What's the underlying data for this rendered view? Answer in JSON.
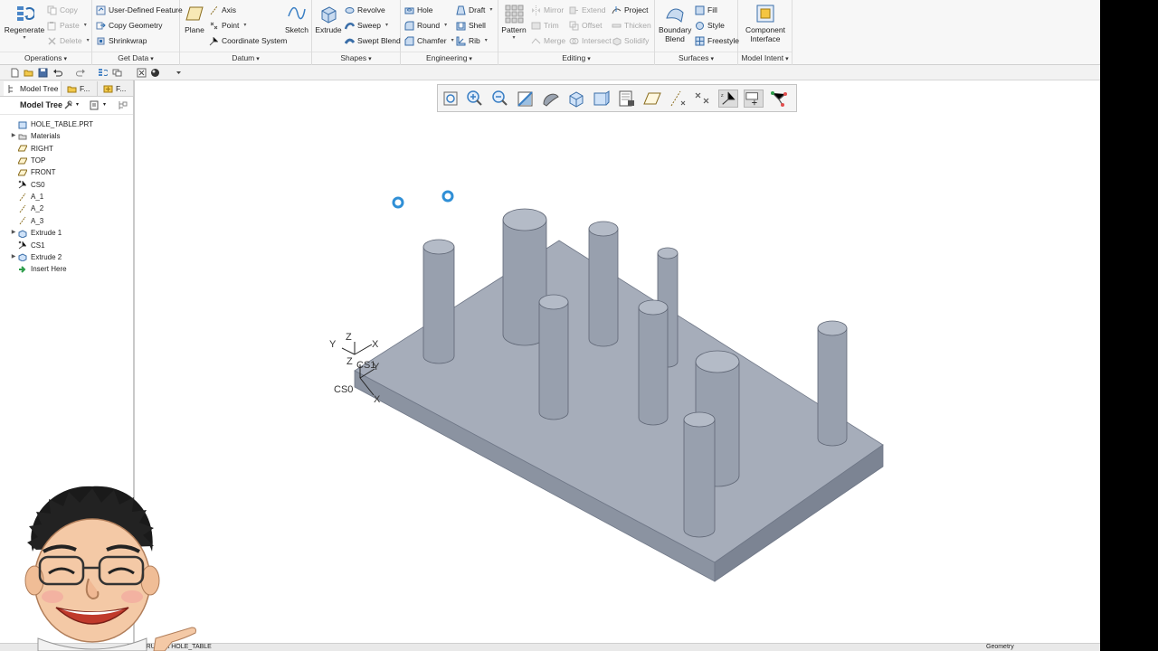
{
  "ribbon": {
    "groups": [
      {
        "label": "Operations"
      },
      {
        "label": "Get Data"
      },
      {
        "label": "Datum"
      },
      {
        "label": "Shapes"
      },
      {
        "label": "Engineering"
      },
      {
        "label": "Editing"
      },
      {
        "label": "Surfaces"
      },
      {
        "label": "Model Intent"
      }
    ],
    "operations": {
      "regenerate": "Regenerate",
      "copy": "Copy",
      "paste": "Paste",
      "delete": "Delete"
    },
    "get_data": {
      "udf": "User-Defined Feature",
      "copy_geometry": "Copy Geometry",
      "shrinkwrap": "Shrinkwrap"
    },
    "datum": {
      "plane": "Plane",
      "axis": "Axis",
      "point": "Point",
      "coordinate_system": "Coordinate System",
      "sketch": "Sketch"
    },
    "shapes": {
      "extrude": "Extrude",
      "revolve": "Revolve",
      "sweep": "Sweep",
      "swept_blend": "Swept Blend"
    },
    "engineering": {
      "hole": "Hole",
      "round": "Round",
      "chamfer": "Chamfer",
      "draft": "Draft",
      "shell": "Shell",
      "rib": "Rib"
    },
    "editing": {
      "pattern": "Pattern",
      "mirror": "Mirror",
      "trim": "Trim",
      "merge": "Merge",
      "extend": "Extend",
      "offset": "Offset",
      "intersect": "Intersect",
      "project": "Project",
      "thicken": "Thicken",
      "solidify": "Solidify"
    },
    "surfaces": {
      "boundary_blend_1": "Boundary",
      "boundary_blend_2": "Blend",
      "fill": "Fill",
      "style": "Style",
      "freestyle": "Freestyle"
    },
    "model_intent": {
      "component_interface_1": "Component",
      "component_interface_2": "Interface"
    }
  },
  "panel": {
    "tabs": [
      {
        "label": "Model Tree"
      },
      {
        "label": "F..."
      },
      {
        "label": "F..."
      }
    ],
    "title": "Model Tree"
  },
  "tree": {
    "items": [
      {
        "label": "HOLE_TABLE.PRT",
        "icon": "part-icon",
        "expandable": false
      },
      {
        "label": "Materials",
        "icon": "materials-icon",
        "expandable": true
      },
      {
        "label": "RIGHT",
        "icon": "datum-plane-icon",
        "expandable": false
      },
      {
        "label": "TOP",
        "icon": "datum-plane-icon",
        "expandable": false
      },
      {
        "label": "FRONT",
        "icon": "datum-plane-icon",
        "expandable": false
      },
      {
        "label": "CS0",
        "icon": "csys-icon",
        "expandable": false
      },
      {
        "label": "A_1",
        "icon": "axis-icon",
        "expandable": false
      },
      {
        "label": "A_2",
        "icon": "axis-icon",
        "expandable": false
      },
      {
        "label": "A_3",
        "icon": "axis-icon",
        "expandable": false
      },
      {
        "label": "Extrude 1",
        "icon": "extrude-icon",
        "expandable": true
      },
      {
        "label": "CS1",
        "icon": "csys-icon",
        "expandable": false
      },
      {
        "label": "Extrude 2",
        "icon": "extrude-icon",
        "expandable": true
      },
      {
        "label": "Insert Here",
        "icon": "insert-arrow-icon",
        "expandable": false
      }
    ]
  },
  "viewport": {
    "csys_labels": {
      "cs1": "CS1",
      "cs0": "CS0",
      "z": "Z",
      "y": "Y",
      "x": "X",
      "z2": "Z",
      "y2": "Y",
      "x2": "X"
    }
  },
  "status": {
    "text": "...0 (EXTRU...   ...t HOLE_TABLE",
    "filter": "Geometry"
  },
  "colors": {
    "accent": "#3a7fc4",
    "model_face": "#a6adba",
    "model_side": "#8b93a1",
    "model_dark": "#6f7787"
  }
}
